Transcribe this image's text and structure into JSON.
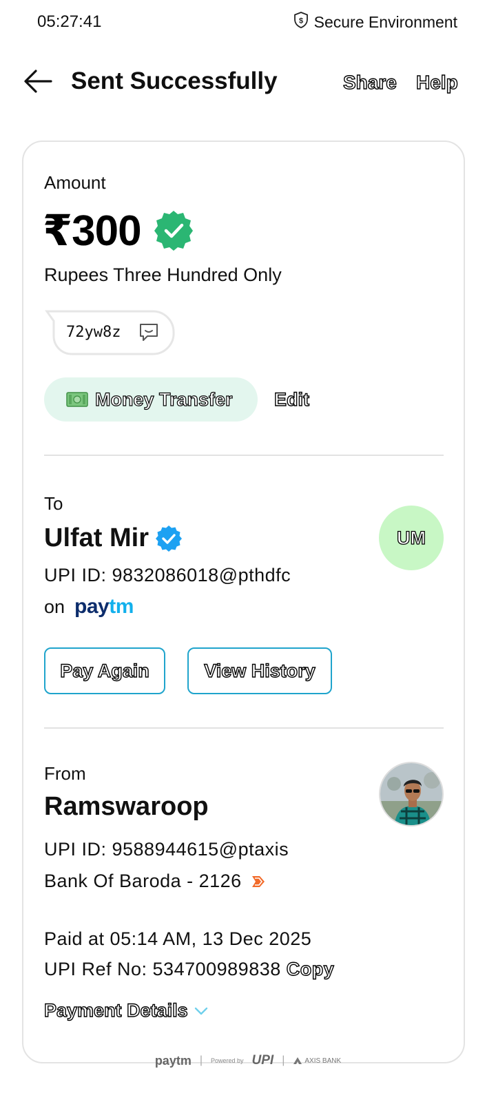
{
  "status_bar": {
    "time": "05:27:41",
    "secure_label": "Secure Environment",
    "secure_icon": "shield-dollar-icon"
  },
  "header": {
    "title": "Sent Successfully",
    "share_label": "Share",
    "help_label": "Help",
    "back_icon": "arrow-left-icon"
  },
  "amount": {
    "label": "Amount",
    "value": "₹300",
    "in_words": "Rupees Three Hundred Only",
    "status_icon": "verified-badge-icon",
    "status_color": "#2bb673"
  },
  "note": {
    "text": "72yw8z",
    "icon": "chat-message-icon"
  },
  "category": {
    "label": "Money Transfer",
    "icon": "money-banknote-icon",
    "edit_label": "Edit",
    "chip_color": "#e3f6ee"
  },
  "recipient": {
    "section_label": "To",
    "name": "Ulfat Mir",
    "upi_id": "UPI ID: 9832086018@pthdfc",
    "on_label": "on",
    "app_logo_pay": "pay",
    "app_logo_tm": "tm",
    "initials": "UM",
    "verified_color": "#1da1f2",
    "pay_again_label": "Pay Again",
    "view_history_label": "View History"
  },
  "sender": {
    "section_label": "From",
    "name": "Ramswaroop",
    "upi_id": "UPI ID: 9588944615@ptaxis",
    "bank": "Bank Of Baroda - 2126",
    "bank_icon": "bank-of-baroda-icon"
  },
  "transaction": {
    "paid_at": "Paid at 05:14 AM, 13 Dec 2025",
    "ref_no": "UPI Ref No: 534700989838",
    "copy_label": "Copy",
    "details_label": "Payment Details"
  },
  "footer": {
    "paytm": "paytm",
    "powered_by": "Powered by",
    "upi": "UPI",
    "bank": "AXIS BANK"
  },
  "colors": {
    "accent": "#1fa4cc",
    "success": "#2bb673",
    "divider": "#e2e2e2"
  }
}
